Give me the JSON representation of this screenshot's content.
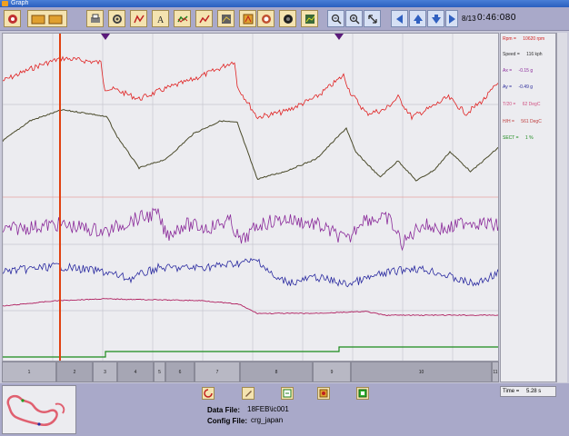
{
  "window": {
    "title": "Graph"
  },
  "toolbar": {
    "buttons": [
      "open-file",
      "folder",
      "print",
      "settings",
      "overlay",
      "text",
      "graph-lines",
      "report",
      "tools",
      "target",
      "fit",
      "zoom-in",
      "zoom-out",
      "zoom-select",
      "prev-left",
      "prev",
      "next-down",
      "next-right"
    ],
    "page_count": "8/13",
    "clock": "0:46:080"
  },
  "readouts": [
    {
      "label": "Rpm",
      "value": "10620 rpm",
      "color": "#d02020"
    },
    {
      "label": "Speed",
      "value": "116 kph",
      "color": "#303030"
    },
    {
      "label": "Ax",
      "value": "-0.15 g",
      "color": "#8a2a9a"
    },
    {
      "label": "Ay",
      "value": "-0.49 g",
      "color": "#2a2a9a"
    },
    {
      "label": "T/20",
      "value": "62 DegC",
      "color": "#d05080"
    },
    {
      "label": "H/H",
      "value": "561 DegC",
      "color": "#c04040"
    },
    {
      "label": "SECT",
      "value": "1 %",
      "color": "#1a8a1a"
    }
  ],
  "sectors": [
    "1",
    "2",
    "3",
    "4",
    "5",
    "6",
    "7",
    "8",
    "9",
    "10",
    "11"
  ],
  "bottom": {
    "data_file_label": "Data File:",
    "data_file": "18FEB\\ic001",
    "config_file_label": "Config File:",
    "config_file": "crg_japan",
    "time_label": "Time =",
    "time_value": "5.28 s"
  },
  "colors": {
    "rpm": "#e02020",
    "speed": "#4a4a2a",
    "ax": "#8a2a9a",
    "ay": "#2a2aa0",
    "temp": "#b02060",
    "sector": "#1a8a1a",
    "cursor": "#e04010"
  }
}
